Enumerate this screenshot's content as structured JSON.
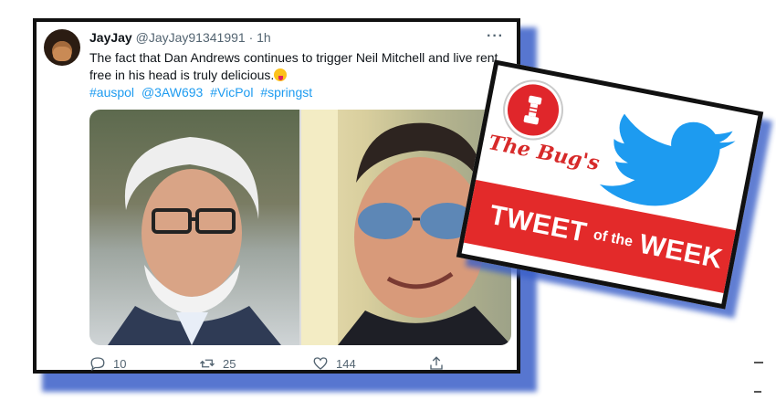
{
  "tweet": {
    "name": "JayJay",
    "handle": "@JayJay91341991",
    "separator": "·",
    "time": "1h",
    "more": "···",
    "text": "The fact that Dan Andrews continues to trigger Neil Mitchell and live rent free in his head is truly delicious.",
    "hashtags": [
      "#auspol",
      "@3AW693",
      "#VicPol",
      "#springst"
    ],
    "counts": {
      "replies": "10",
      "retweets": "25",
      "likes": "144"
    }
  },
  "badge": {
    "title": "The Bug's",
    "banner_big_1": "TWEET",
    "banner_small": "of the",
    "banner_big_2": "WEEK"
  },
  "colors": {
    "accent": "#1d9bf0",
    "red": "#e32a2a",
    "shadow": "#3a5fc8"
  },
  "icons": [
    "reply-icon",
    "retweet-icon",
    "like-icon",
    "share-icon",
    "twitter-bird-icon",
    "bug-logo-icon",
    "more-options-icon"
  ]
}
